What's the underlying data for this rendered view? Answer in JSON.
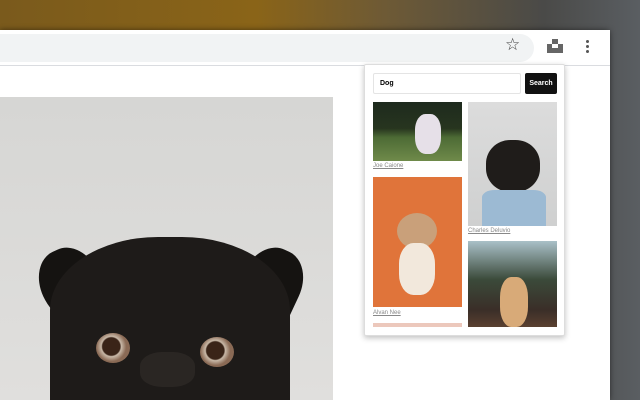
{
  "toolbar": {
    "bookmark_icon": "star-icon",
    "extension_icon": "unsplash-icon",
    "menu_icon": "kebab-menu-icon"
  },
  "popup": {
    "search_value": "Dog",
    "search_button": "Search",
    "photos": [
      {
        "credit": "Joe Caione"
      },
      {
        "credit": "Charles Deluvio"
      },
      {
        "credit": "Alvan Nee"
      },
      {
        "credit": ""
      }
    ]
  }
}
